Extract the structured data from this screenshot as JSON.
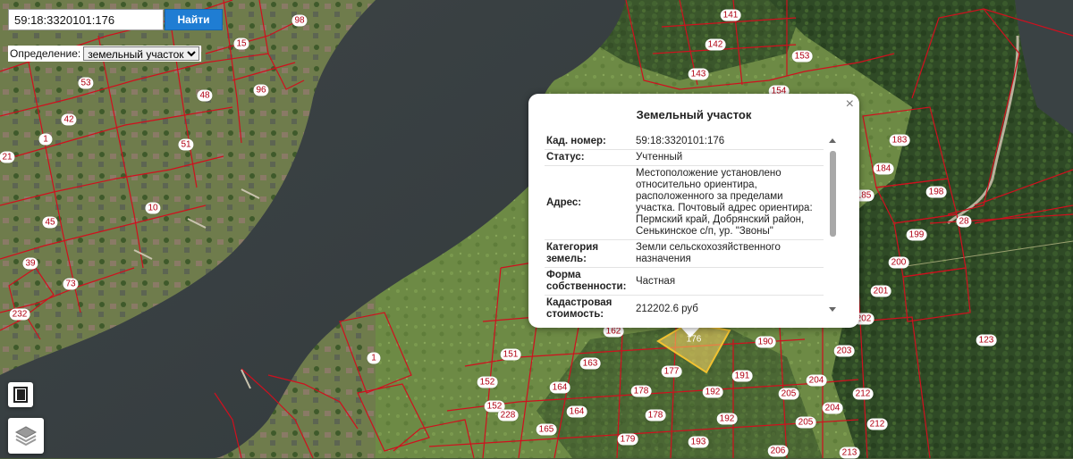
{
  "search": {
    "query": "59:18:3320101:176",
    "button_label": "Найти",
    "definition_label": "Определение:",
    "definition_options": [
      "земельный участок"
    ],
    "definition_selected": "земельный участок"
  },
  "popup": {
    "title": "Земельный участок",
    "close_symbol": "×",
    "rows": [
      {
        "key": "Кад. номер:",
        "value": "59:18:3320101:176"
      },
      {
        "key": "Статус:",
        "value": "Учтенный"
      },
      {
        "key": "Адрес:",
        "value": "Местоположение установлено относительно ориентира, расположенного за пределами участка. Почтовый адрес ориентира: Пермский край, Добрянский район, Сенькинское с/п, ур. \"Звоны\""
      },
      {
        "key": "Категория земель:",
        "value": "Земли сельскохозяйственного назначения"
      },
      {
        "key": "Форма собственности:",
        "value": "Частная"
      },
      {
        "key": "Кадастровая стоимость:",
        "value": "212202.6 руб"
      }
    ]
  },
  "map": {
    "highlighted_parcel": "176",
    "highlight_color": "#ffd966",
    "boundary_color": "#d0101e",
    "parcel_labels": [
      "98",
      "15",
      "53",
      "96",
      "48",
      "42",
      "51",
      "1",
      "21",
      "45",
      "10",
      "39",
      "73",
      "232",
      "141",
      "142",
      "153",
      "143",
      "154",
      "183",
      "184",
      "185",
      "198",
      "28",
      "199",
      "200",
      "201",
      "202",
      "123",
      "203",
      "190",
      "162",
      "176",
      "151",
      "163",
      "177",
      "191",
      "152",
      "164",
      "178",
      "192",
      "205",
      "204",
      "212",
      "152",
      "228",
      "164",
      "178",
      "192",
      "165",
      "179",
      "193",
      "206",
      "213",
      "205",
      "204",
      "212",
      "1"
    ],
    "tools": [
      "ruler-icon",
      "layers-icon"
    ]
  }
}
